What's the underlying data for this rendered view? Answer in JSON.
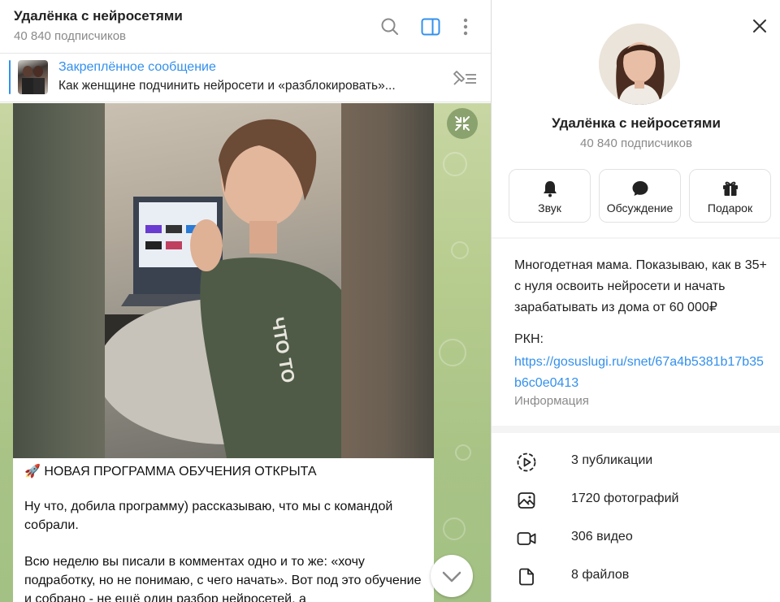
{
  "chat": {
    "title": "Удалёнка с нейросетями",
    "subtitle": "40 840 подписчиков",
    "pinned": {
      "title": "Закреплённое сообщение",
      "text": "Как женщине подчинить нейросети и «разблокировать»..."
    },
    "message": {
      "headline": "🚀 НОВАЯ ПРОГРАММА ОБУЧЕНИЯ ОТКРЫТА",
      "paragraph1": "Ну что, добила программу) рассказываю, что мы с командой собрали.",
      "paragraph2": "Всю неделю вы писали в комментах одно и то же: «хочу подработку, но не понимаю, с чего начать». Вот под это обучение и собрано - не ещё один разбор нейросетей, а"
    }
  },
  "profile": {
    "name": "Удалёнка с нейросетями",
    "subscribers": "40 840 подписчиков",
    "actions": [
      {
        "label": "Звук",
        "icon": "bell-icon"
      },
      {
        "label": "Обсуждение",
        "icon": "chat-bubble-icon"
      },
      {
        "label": "Подарок",
        "icon": "gift-icon"
      }
    ],
    "description": "Многодетная мама. Показываю, как в 35+ с нуля освоить нейросети и начать зарабатывать из дома от 60 000₽",
    "rkn_label": "РКН:",
    "rkn_link": "https://gosuslugi.ru/snet/67a4b5381b17b35b6c0e0413",
    "info_label": "Информация",
    "stats": [
      {
        "label": "3 публикации",
        "icon": "stories-icon"
      },
      {
        "label": "1720 фотографий",
        "icon": "photo-icon"
      },
      {
        "label": "306 видео",
        "icon": "video-icon"
      },
      {
        "label": "8 файлов",
        "icon": "file-icon"
      }
    ]
  },
  "colors": {
    "accent": "#3390ec",
    "chat_background": "#b7cc8f",
    "muted_text": "#8a8a8a"
  }
}
